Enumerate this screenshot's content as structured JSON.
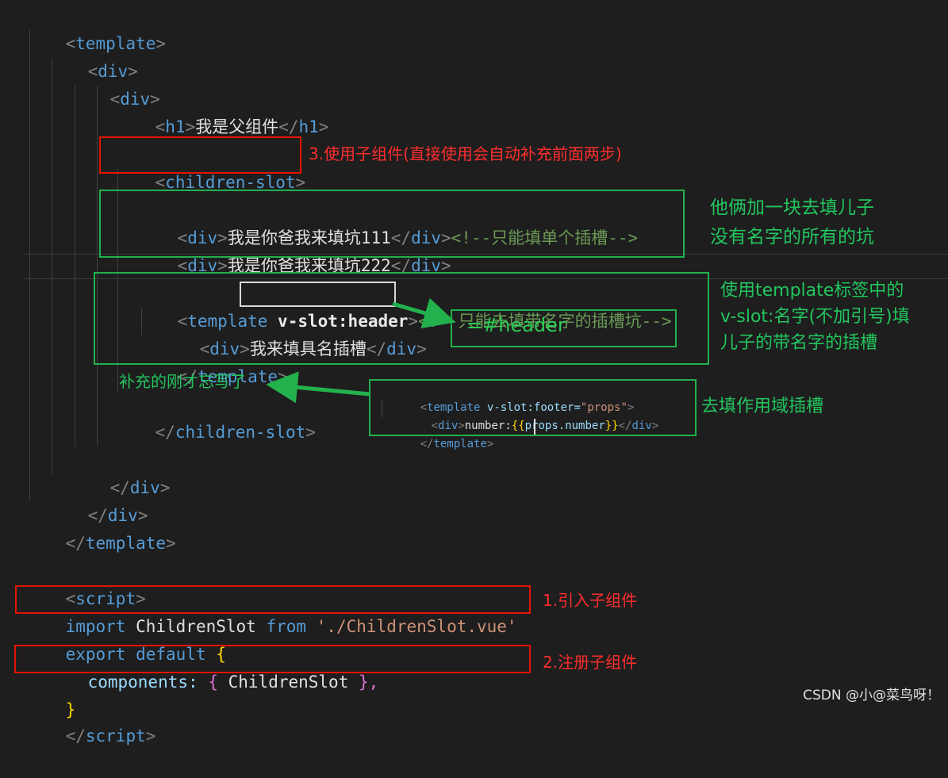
{
  "code": {
    "template_open": {
      "bracket_open": "<",
      "tag": "template",
      "bracket_close": ">"
    },
    "div_outer_open": {
      "bracket_open": "<",
      "tag": "div",
      "bracket_close": ">"
    },
    "div_inner_open": {
      "bracket_open": "<",
      "tag": "div",
      "bracket_close": ">"
    },
    "h1_line": {
      "open": "<",
      "tag": "h1",
      "close": ">",
      "text": "我是父组件",
      "end_open": "</",
      "end_tag": "h1",
      "end_close": ">"
    },
    "children_slot_open": {
      "bracket_open": "<",
      "tag": "children-slot",
      "bracket_close": ">"
    },
    "fill_line_1": {
      "open": "<",
      "tag": "div",
      "close": ">",
      "text": "我是你爸我来填坑111",
      "end_open": "</",
      "end_tag": "div",
      "end_close": ">",
      "comment": "<!--只能填单个插槽-->"
    },
    "fill_line_2": {
      "open": "<",
      "tag": "div",
      "close": ">",
      "text": "我是你爸我来填坑222",
      "end_open": "</",
      "end_tag": "div",
      "end_close": ">"
    },
    "named_template_open": {
      "open": "<",
      "tag": "template",
      "attr": "v-slot:header",
      "close": ">",
      "comment": "<!--只能去填带名字的插槽坑-->"
    },
    "named_fill_line": {
      "open": "<",
      "tag": "div",
      "close": ">",
      "text": "我来填具名插槽",
      "end_open": "</",
      "end_tag": "div",
      "end_close": ">"
    },
    "named_template_close": {
      "open": "</",
      "tag": "template",
      "close": ">"
    },
    "children_slot_close": {
      "open": "</",
      "tag": "children-slot",
      "close": ">"
    },
    "div_inner_close": {
      "open": "</",
      "tag": "div",
      "close": ">"
    },
    "div_outer_close": {
      "open": "</",
      "tag": "div",
      "close": ">"
    },
    "template_close": {
      "open": "</",
      "tag": "template",
      "close": ">"
    },
    "script_open": {
      "open": "<",
      "tag": "script",
      "close": ">"
    },
    "import_line": {
      "keyword": "import",
      "ident": "ChildrenSlot",
      "from": "from",
      "string": "'./ChildrenSlot.vue'"
    },
    "export_line": {
      "export": "export",
      "default": "default",
      "brace": "{"
    },
    "components_line": {
      "prop": "components:",
      "brace_open": "{",
      "ident": "ChildrenSlot",
      "brace_close": "},"
    },
    "close_brace": "}",
    "script_close": {
      "open": "</",
      "tag": "script",
      "close": ">"
    }
  },
  "annotations": {
    "use_child": "3.使用子组件(直接使用会自动补充前面两步)",
    "import_child": "1.引入子组件",
    "register_child": "2.注册子组件",
    "together_line1": "他俩加一块去填儿子",
    "together_line2": "没有名字的所有的坑",
    "named_line1": "使用template标签中的",
    "named_line2": "v-slot:名字(不加引号)填",
    "named_line3": "儿子的带名字的插槽",
    "hash_shorthand": "=#header",
    "forgot": "补充的刚才忘写了",
    "scoped_fill": "去填作用域插槽"
  },
  "scoped_snippet": {
    "line1": {
      "open": "<",
      "tag": "template",
      "attr": "v-slot:footer=",
      "value": "\"props\"",
      "close": ">"
    },
    "line2": {
      "open": "<",
      "tag": "div",
      "close": ">",
      "text": "number:",
      "mustache_open": "{{",
      "expr": "props.number",
      "mustache_close": "}}",
      "end_open": "</",
      "end_tag": "div",
      "end_close": ">"
    },
    "line3": {
      "open": "</",
      "tag": "template",
      "close": ">"
    }
  },
  "watermark": "CSDN @小@菜鸟呀！",
  "colors": {
    "background": "#1e1e1e",
    "red_box": "#e51400",
    "green_box": "#22b14c",
    "tag": "#569cd6",
    "comment": "#6a9955"
  }
}
